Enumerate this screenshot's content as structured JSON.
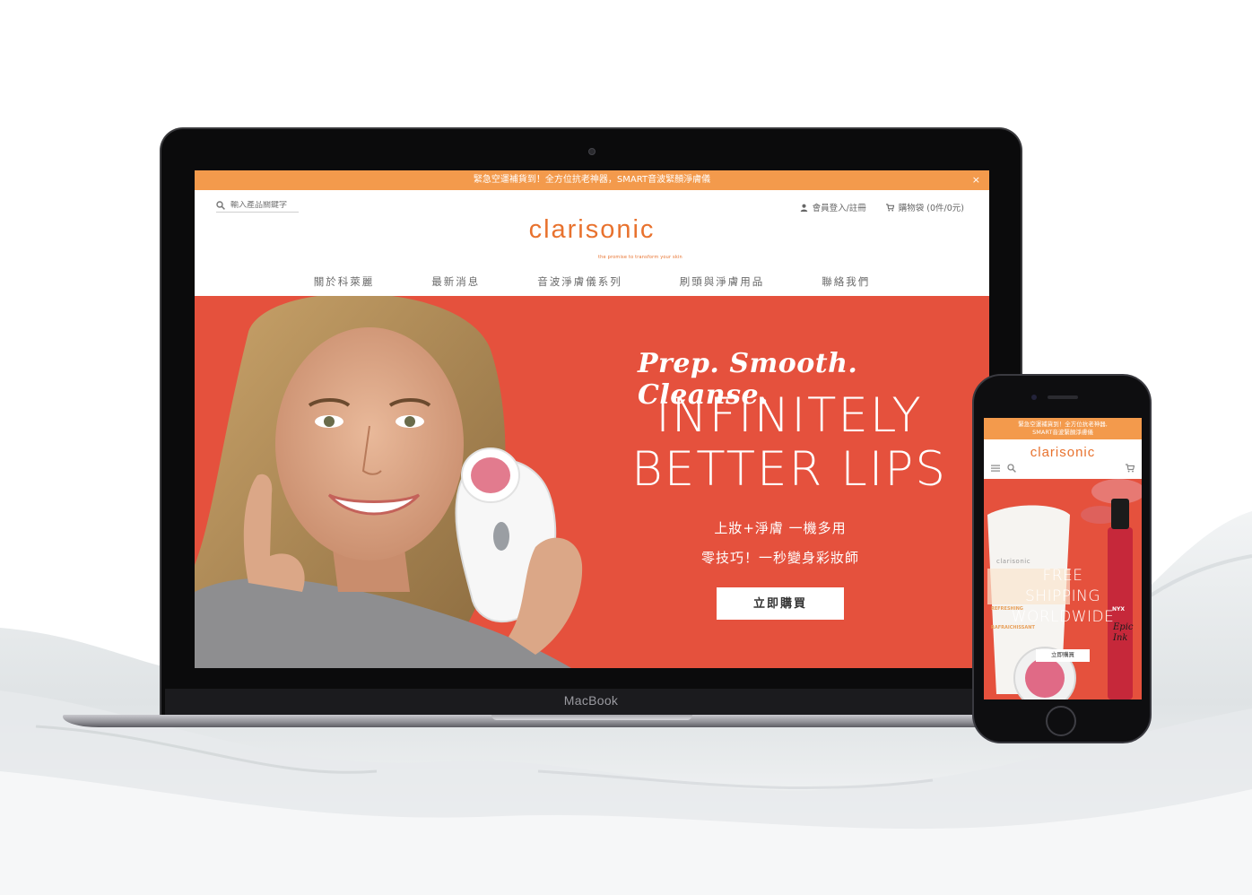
{
  "laptop": {
    "device_label": "MacBook",
    "announcement": "緊急空運補貨到！全方位抗老神器，SMART音波緊顏淨膚儀",
    "close_label": "×",
    "search": {
      "placeholder": "輸入產品關鍵字"
    },
    "account": {
      "login_label": "會員登入/註冊",
      "cart_label": "購物袋 (0件/0元)"
    },
    "logo": "clarisonic",
    "tagline": "the promise to transform your skin",
    "nav": [
      {
        "label": "關於科萊麗"
      },
      {
        "label": "最新消息"
      },
      {
        "label": "音波淨膚儀系列"
      },
      {
        "label": "刷頭與淨膚用品"
      },
      {
        "label": "聯絡我們"
      }
    ],
    "hero": {
      "script_line": "Prep. Smooth. Cleanse.",
      "headline_1": "INFINITELY",
      "headline_2": "BETTER LIPS",
      "sub_1": "上妝+淨膚 一機多用",
      "sub_2": "零技巧！一秒變身彩妝師",
      "cta_label": "立即購買"
    }
  },
  "phone": {
    "announcement_1": "緊急空運補貨到！全方位抗老神器,",
    "announcement_2": "SMART音波緊顏淨膚儀",
    "logo": "clarisonic",
    "hero": {
      "line_1": "FREE",
      "line_2": "SHIPPING",
      "line_3": "WORLDWIDE",
      "cta_label": "立即購買",
      "product_brand": "clarisonic",
      "product_tag": "REFRESHING",
      "product_tag_fr": "RAFRAICHISSANT",
      "lip_brand": "NYX",
      "lip_name": "Epic Ink"
    }
  },
  "colors": {
    "brand_orange": "#e8722e",
    "announcement_bg": "#f39a4c",
    "hero_red": "#e5513d"
  }
}
